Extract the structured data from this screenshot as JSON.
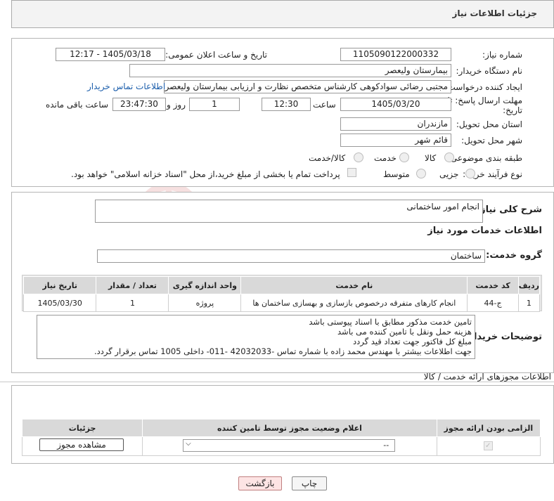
{
  "header": {
    "title": "جزئیات اطلاعات نیاز"
  },
  "form": {
    "need_number": {
      "label": "شماره نیاز:",
      "value": "1105090122000332"
    },
    "announce_datetime": {
      "label": "تاریخ و ساعت اعلان عمومی:",
      "value": "1405/03/18 - 12:17"
    },
    "buyer_org": {
      "label": "نام دستگاه خریدار:",
      "value": "بیمارستان ولیعصر"
    },
    "requester": {
      "label": "ایجاد کننده درخواست:",
      "value": "مجتبی رضائی سوادکوهی کارشناس متخصص نظارت و ارزیابی بیمارستان ولیعصر"
    },
    "buyer_contact_link": "اطلاعات تماس خریدار",
    "deadline": {
      "label_line1": "مهلت ارسال پاسخ: تا",
      "label_line2": "تاریخ:",
      "date": "1405/03/20",
      "time_label": "ساعت",
      "time": "12:30",
      "days": "1",
      "days_label": "روز و",
      "remaining": "23:47:30",
      "remaining_label": "ساعت باقی مانده"
    },
    "province": {
      "label": "استان محل تحویل:",
      "value": "مازندران"
    },
    "city": {
      "label": "شهر محل تحویل:",
      "value": "قائم شهر"
    },
    "category": {
      "label": "طبقه بندی موضوعی:",
      "options": [
        "کالا",
        "خدمت",
        "کالا/خدمت"
      ]
    },
    "purchase_type": {
      "label": "نوع فرآیند خرید :",
      "options": [
        "جزیی",
        "متوسط"
      ],
      "treasury_note": "پرداخت تمام یا بخشی از مبلغ خرید،از محل \"اسناد خزانه اسلامی\" خواهد بود."
    }
  },
  "general": {
    "summary_label": "شرح کلی نیاز:",
    "summary_value": "انجام امور ساختمانی",
    "services_title": "اطلاعات خدمات مورد نیاز",
    "service_group_label": "گروه خدمت:",
    "service_group_value": "ساختمان",
    "table": {
      "headers": [
        "ردیف",
        "کد خدمت",
        "نام خدمت",
        "واحد اندازه گیری",
        "تعداد / مقدار",
        "تاریخ نیاز"
      ],
      "rows": [
        [
          "1",
          "ج-44",
          "انجام کارهای متفرقه درخصوص بازسازی و بهسازی ساختمان ها",
          "پروژه",
          "1",
          "1405/03/30"
        ]
      ]
    },
    "buyer_notes_label": "توضیحات خریدار:",
    "buyer_notes": [
      "تامین خدمت مذکور مطابق با اسناد پیوستی باشد",
      "هزینه حمل ونقل با تامین کننده می باشد",
      "مبلغ کل  فاکتور جهت تعداد قید گردد",
      "جهت اطلاعات بیشتر با مهندس محمد زاده با شماره تماس -42032033 -011- داخلی 1005 تماس برقرار گردد."
    ]
  },
  "permits": {
    "section_title": "اطلاعات مجوزهای ارائه خدمت / کالا",
    "headers": [
      "الزامی بودن ارائه مجوز",
      "اعلام وضعیت مجوز توسط تامین کننده",
      "جزئیات"
    ],
    "select_value": "--",
    "view_button": "مشاهده مجوز"
  },
  "buttons": {
    "print": "چاپ",
    "back": "بازگشت"
  },
  "watermark": "AriaTender.neT"
}
